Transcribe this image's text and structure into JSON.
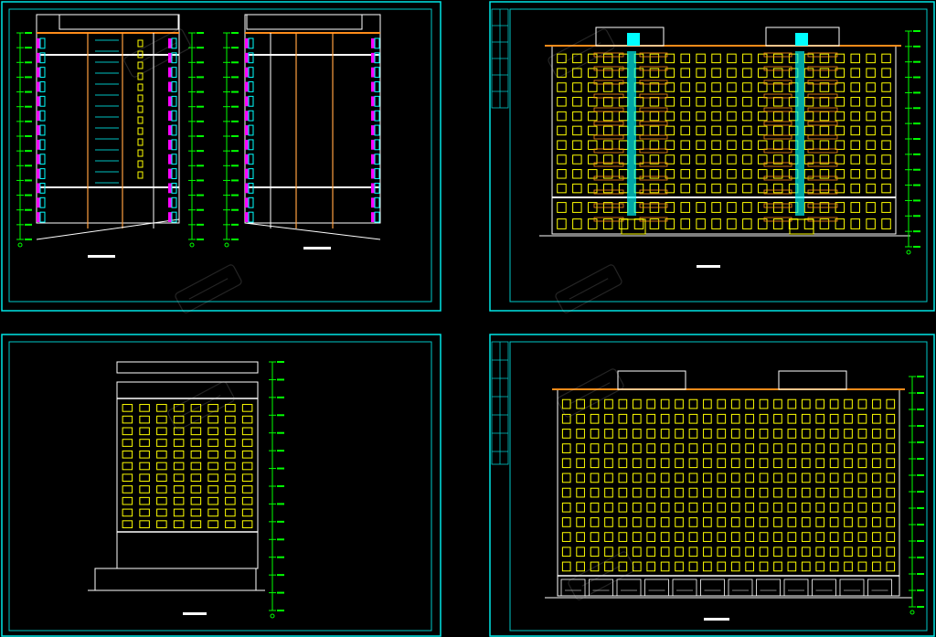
{
  "colors": {
    "background": "#000000",
    "frame": "#00e5e5",
    "inner_frame": "#00c8c8",
    "outline": "#ffffff",
    "window": "#ffff00",
    "balcony_glass": "#00ffff",
    "balcony_side": "#ff00ff",
    "column": "#ffa040",
    "roof_trim": "#ff8c1a",
    "level_marker": "#00ff00",
    "watermark": "rgba(200,200,200,0.18)"
  },
  "sheets": [
    {
      "view": "section-pair"
    },
    {
      "view": "front-elevation"
    },
    {
      "view": "side-elevation"
    },
    {
      "view": "rear-elevation"
    }
  ],
  "icons": [
    "level-marker-icon",
    "grid-axis-icon",
    "watermark-logo-icon"
  ]
}
